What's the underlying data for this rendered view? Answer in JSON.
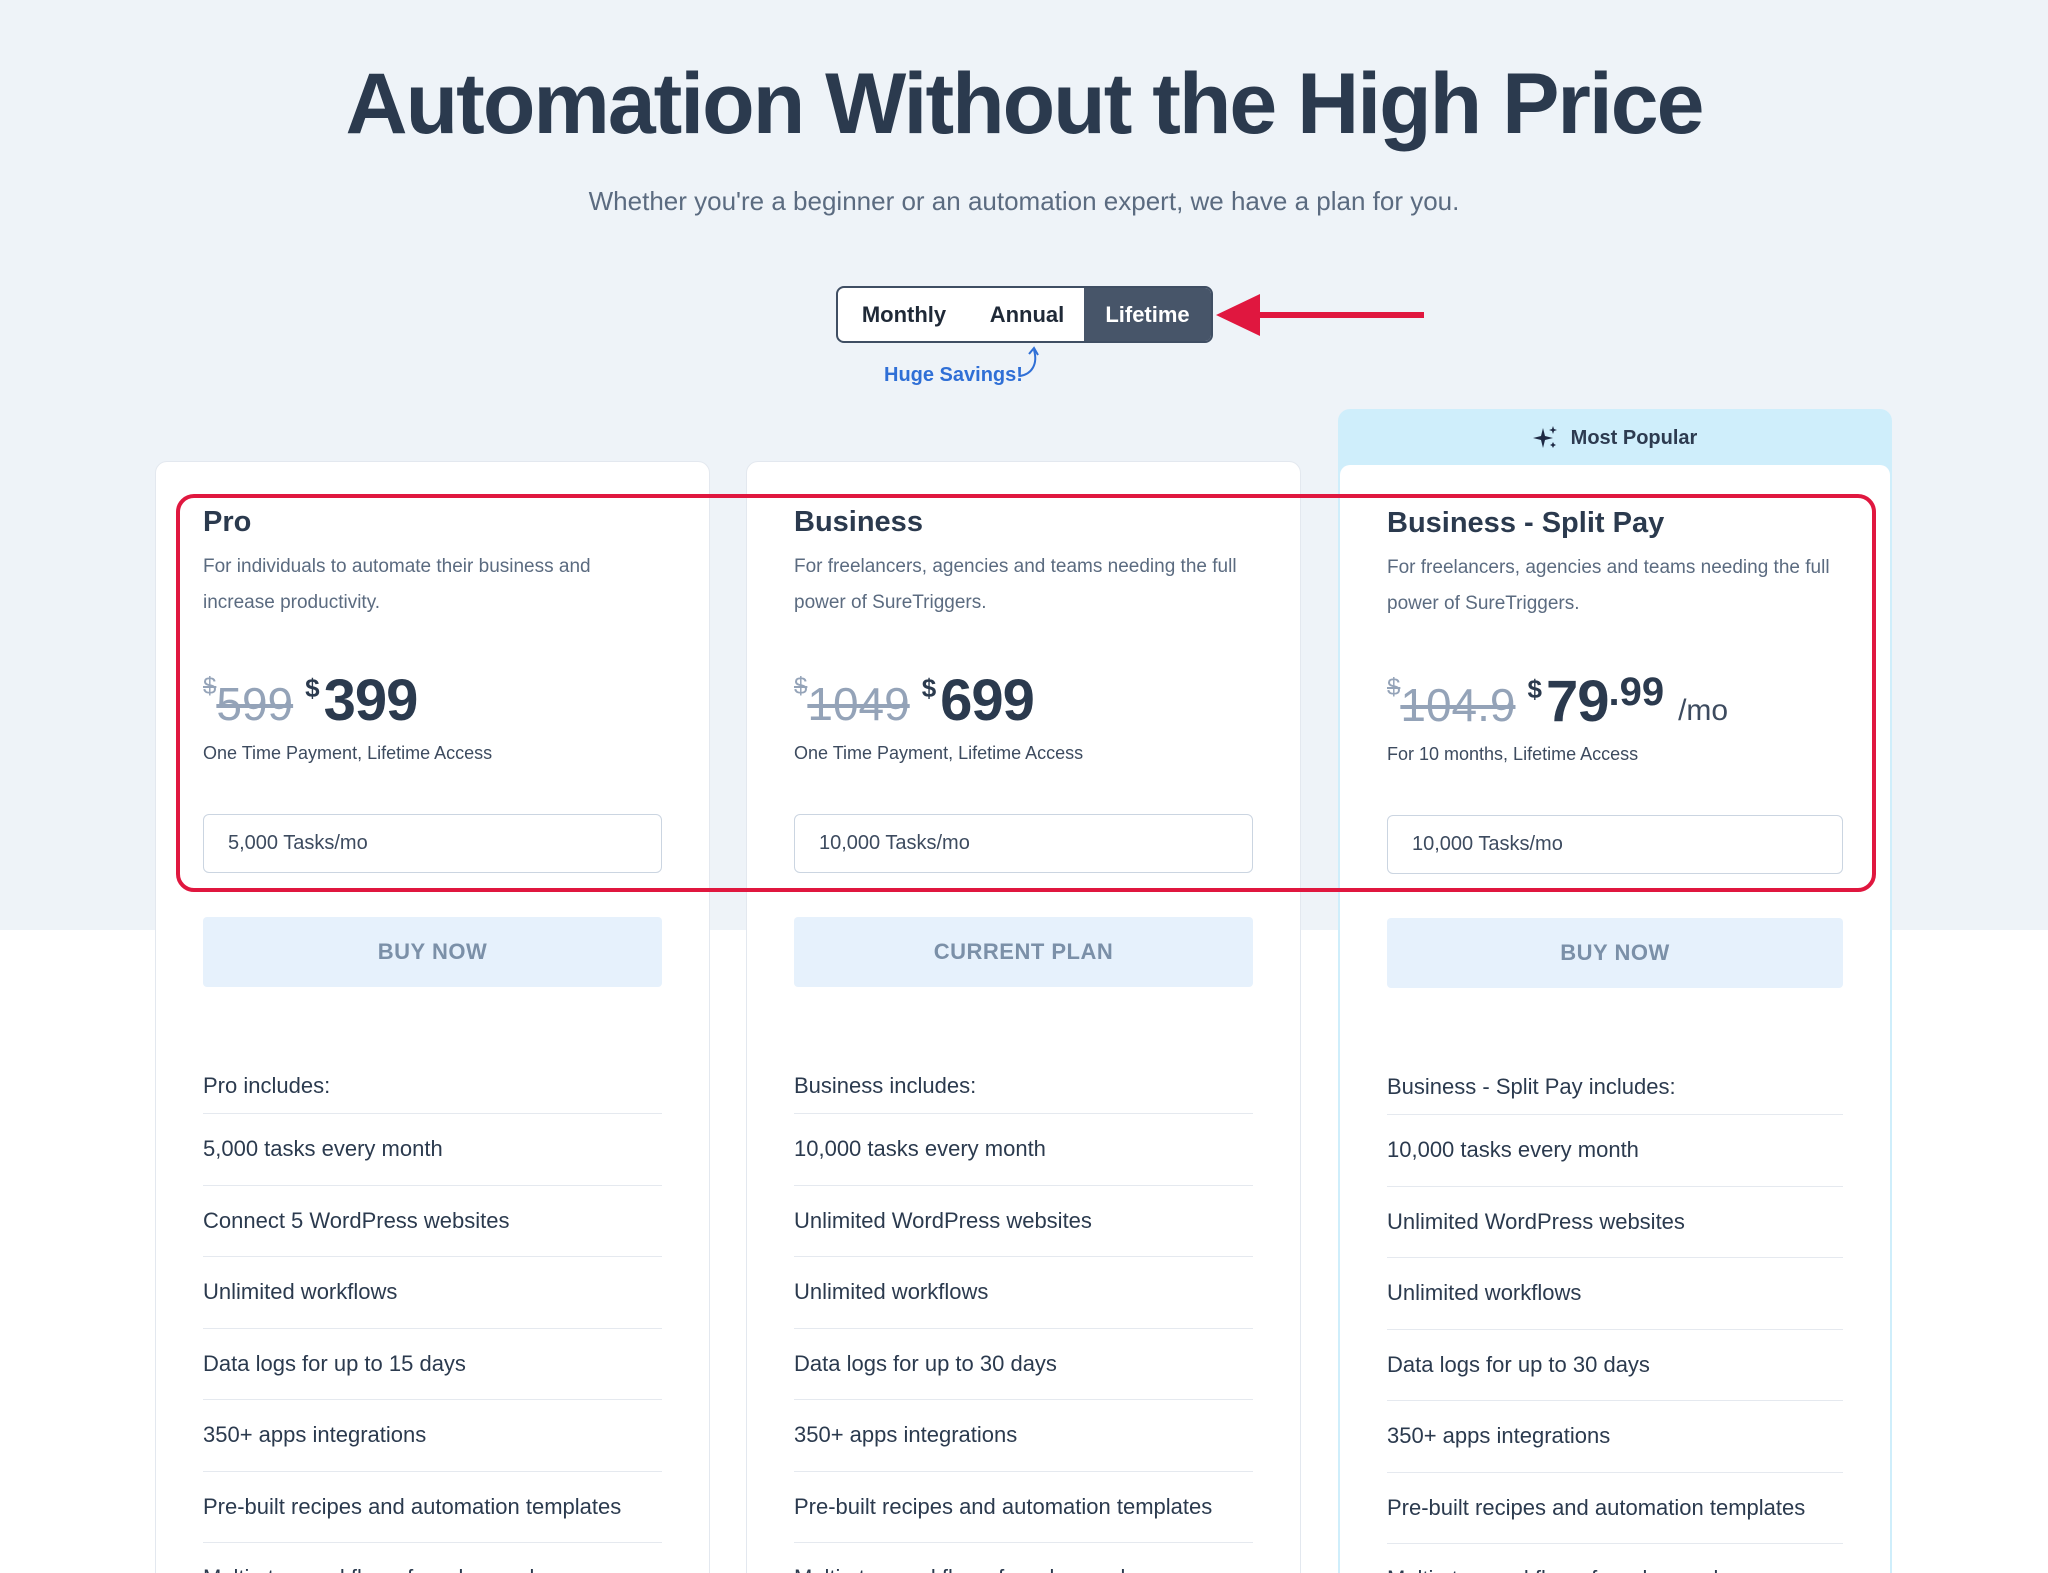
{
  "header": {
    "title": "Automation Without the High Price",
    "subtitle": "Whether you're a beginner or an automation expert, we have a plan for you."
  },
  "billing_toggle": {
    "options": [
      "Monthly",
      "Annual",
      "Lifetime"
    ],
    "selected": "Lifetime",
    "savings_note": "Huge Savings!"
  },
  "colors": {
    "annotation_red": "#e0173f",
    "selected_toggle": "#475569",
    "popular_bg": "#cfeefb",
    "button_bg": "#e6f1fc"
  },
  "plans": [
    {
      "name": "Pro",
      "description": "For individuals to automate their business and increase productivity.",
      "old_currency": "$",
      "old_price": "599",
      "currency": "$",
      "price": "399",
      "price_decimal": "",
      "per": "",
      "price_note": "One Time Payment, Lifetime Access",
      "tasks": "5,000 Tasks/mo",
      "button": "BUY NOW",
      "includes_title": "Pro includes:",
      "features": [
        "5,000 tasks every month",
        "Connect 5 WordPress websites",
        "Unlimited workflows",
        "Data logs for up to 15 days",
        "350+ apps integrations",
        "Pre-built recipes and automation templates",
        "Multi-step workflows for advanced"
      ]
    },
    {
      "name": "Business",
      "description": "For freelancers, agencies and teams needing the full power of SureTriggers.",
      "old_currency": "$",
      "old_price": "1049",
      "currency": "$",
      "price": "699",
      "price_decimal": "",
      "per": "",
      "price_note": "One Time Payment, Lifetime Access",
      "tasks": "10,000 Tasks/mo",
      "button": "CURRENT PLAN",
      "includes_title": "Business includes:",
      "features": [
        "10,000 tasks every month",
        "Unlimited WordPress websites",
        "Unlimited workflows",
        "Data logs for up to 30 days",
        "350+ apps integrations",
        "Pre-built recipes and automation templates",
        "Multi-step workflows for advanced"
      ]
    },
    {
      "badge": "Most Popular",
      "name": "Business - Split Pay",
      "description": "For freelancers, agencies and teams needing the full power of SureTriggers.",
      "old_currency": "$",
      "old_price": "104.9",
      "currency": "$",
      "price": "79",
      "price_decimal": ".99",
      "per": "/mo",
      "price_note": "For 10 months, Lifetime Access",
      "tasks": "10,000 Tasks/mo",
      "button": "BUY NOW",
      "includes_title": "Business - Split Pay includes:",
      "features": [
        "10,000 tasks every month",
        "Unlimited WordPress websites",
        "Unlimited workflows",
        "Data logs for up to 30 days",
        "350+ apps integrations",
        "Pre-built recipes and automation templates",
        "Multi-step workflows for advanced"
      ]
    }
  ]
}
